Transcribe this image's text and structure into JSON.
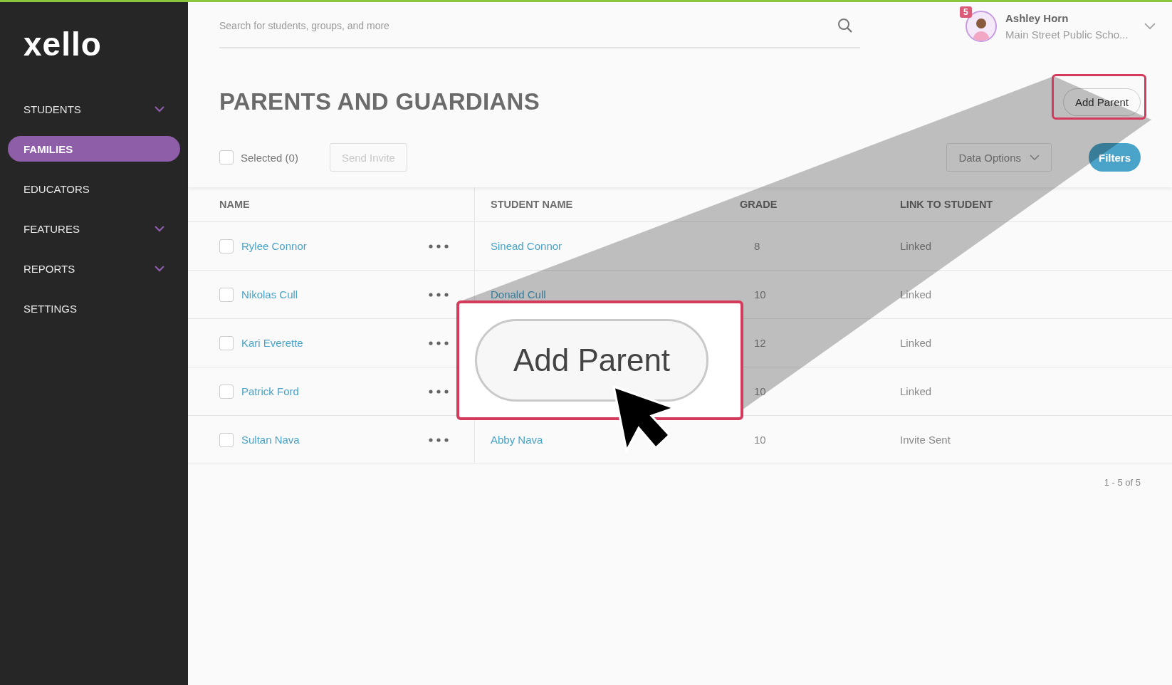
{
  "sidebar": {
    "logo": "xello",
    "items": [
      {
        "label": "STUDENTS",
        "has_menu": true,
        "selected": false
      },
      {
        "label": "FAMILIES",
        "has_menu": false,
        "selected": true
      },
      {
        "label": "EDUCATORS",
        "has_menu": false,
        "selected": false
      },
      {
        "label": "FEATURES",
        "has_menu": true,
        "selected": false
      },
      {
        "label": "REPORTS",
        "has_menu": true,
        "selected": false
      },
      {
        "label": "SETTINGS",
        "has_menu": false,
        "selected": false
      }
    ]
  },
  "header": {
    "search": {
      "placeholder": "Search for students, groups, and more"
    },
    "user": {
      "badge": "5",
      "name": "Ashley Horn",
      "school": "Main Street Public Scho..."
    }
  },
  "page": {
    "title": "PARENTS AND GUARDIANS",
    "add_button": "Add Parent"
  },
  "toolbar": {
    "select_all": {
      "label": "Selected (0)",
      "checked": false
    },
    "send_invite": {
      "label": "Send Invite",
      "disabled": true
    },
    "data_options": "Data Options",
    "filters": "Filters"
  },
  "table": {
    "columns": [
      "NAME",
      "STUDENT NAME",
      "GRADE",
      "LINK TO STUDENT"
    ],
    "rows": [
      {
        "checked": false,
        "name": "Rylee Connor",
        "student": "Sinead Connor",
        "grade": "8",
        "link": "Linked"
      },
      {
        "checked": false,
        "name": "Nikolas Cull",
        "student": "Donald Cull",
        "grade": "10",
        "link": "Linked"
      },
      {
        "checked": false,
        "name": "Kari Everette",
        "grade": "12",
        "link": "Linked"
      },
      {
        "checked": false,
        "name": "Patrick Ford",
        "grade": "10",
        "link": "Linked"
      },
      {
        "checked": false,
        "name": "Sultan Nava",
        "student": "Abby Nava",
        "grade": "10",
        "link": "Invite Sent"
      }
    ]
  },
  "pagination": "1 - 5 of 5",
  "callout": {
    "label": "Add Parent"
  }
}
